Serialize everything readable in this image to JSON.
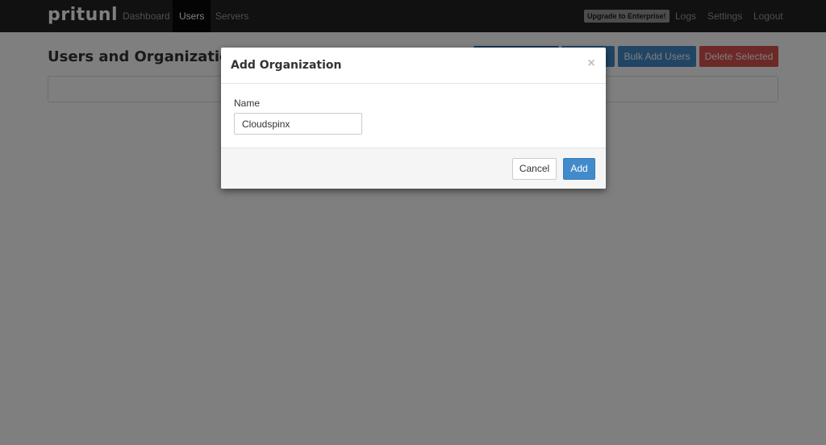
{
  "navbar": {
    "brand": "pritunl",
    "links": [
      {
        "label": "Dashboard",
        "active": false
      },
      {
        "label": "Users",
        "active": true
      },
      {
        "label": "Servers",
        "active": false
      }
    ],
    "upgrade_label": "Upgrade to Enterprise!",
    "right_links": [
      {
        "label": "Logs"
      },
      {
        "label": "Settings"
      },
      {
        "label": "Logout"
      }
    ]
  },
  "page": {
    "title": "Users and Organizations",
    "buttons": {
      "bulk_add_users": "Bulk Add Users",
      "delete_selected": "Delete Selected"
    }
  },
  "modal": {
    "title": "Add Organization",
    "close_glyph": "×",
    "name_label": "Name",
    "name_value": "Cloudspinx",
    "cancel_label": "Cancel",
    "add_label": "Add"
  },
  "colors": {
    "navbar_bg": "#222222",
    "primary": "#428bca",
    "danger": "#d9534f",
    "backdrop": "rgba(0,0,0,0.5)"
  }
}
